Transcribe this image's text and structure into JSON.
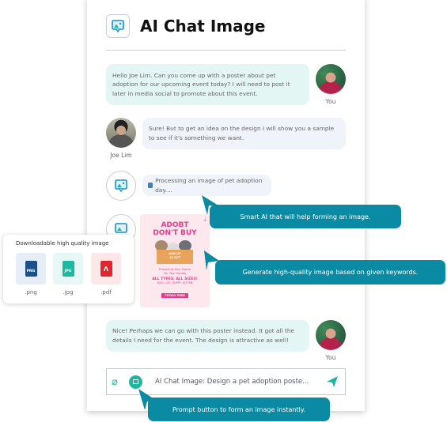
{
  "header": {
    "title": "AI Chat Image",
    "icon": "image-chat-icon"
  },
  "messages": [
    {
      "sender": "You",
      "text": "Hello Joe Lim. Can you come up with a poster about pet adoption for our upcoming event today? I will need to post it later in media social to promote about this event."
    },
    {
      "sender": "Joe Lim",
      "text": "Sure! But to get an idea on the design I will show you a sample to see if it's something we want."
    },
    {
      "sender": "AI",
      "text": "Processing an image of pet adoption day...."
    },
    {
      "sender": "You",
      "text": "Nice! Perhaps we can go with this poster instead. It got all the details I need for the event. The design is attractive as well!"
    }
  ],
  "poster": {
    "headline1": "ADOBT",
    "headline2": "DON'T BUY",
    "join": "JOIN US",
    "date": "15 OCT",
    "line1": "Preparing Your Home",
    "line2": "For Your Buddy",
    "types": "ALL TYPES, ALL SIZES!",
    "pets": "DOG, CAT, PUPPY, KITTEN",
    "free": "TOTALY FREE"
  },
  "download_card": {
    "title": "Downloadable high quality image",
    "formats": [
      {
        "label": ".png",
        "badge": "PNG",
        "color": "#1d4f8a",
        "bg": "#e6edf6"
      },
      {
        "label": ".jpg",
        "badge": "JPG",
        "color": "#1cb8a0",
        "bg": "#e6f8f6"
      },
      {
        "label": ".pdf",
        "badge": "",
        "color": "#e0262e",
        "bg": "#fde7e8"
      }
    ]
  },
  "callouts": [
    "Smart AI that will help forming an image.",
    "Generate high-quality image based on given keywords.",
    "Prompt button to form an image instantly."
  ],
  "input": {
    "value": "AI Chat Image: Design a pet adoption poste..."
  },
  "colors": {
    "accent": "#0a8aa3",
    "teal": "#1cb8a0",
    "user_bubble": "#e3f6f4",
    "ai_bubble": "#f0f3f9"
  }
}
